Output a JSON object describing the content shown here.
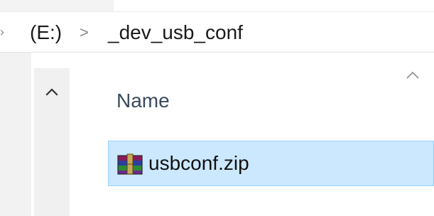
{
  "address_bar": {
    "drive": "(E:)",
    "separator": ">",
    "current_folder": "_dev_usb_conf"
  },
  "file_list": {
    "column_header": "Name",
    "sort": "ascending",
    "items": [
      {
        "name": "usbconf.zip",
        "icon": "winrar-archive-icon",
        "selected": true
      }
    ]
  },
  "colors": {
    "selection_bg": "#cce8ff",
    "selection_border": "#99d1ff",
    "header_text": "#3a4a5e"
  }
}
